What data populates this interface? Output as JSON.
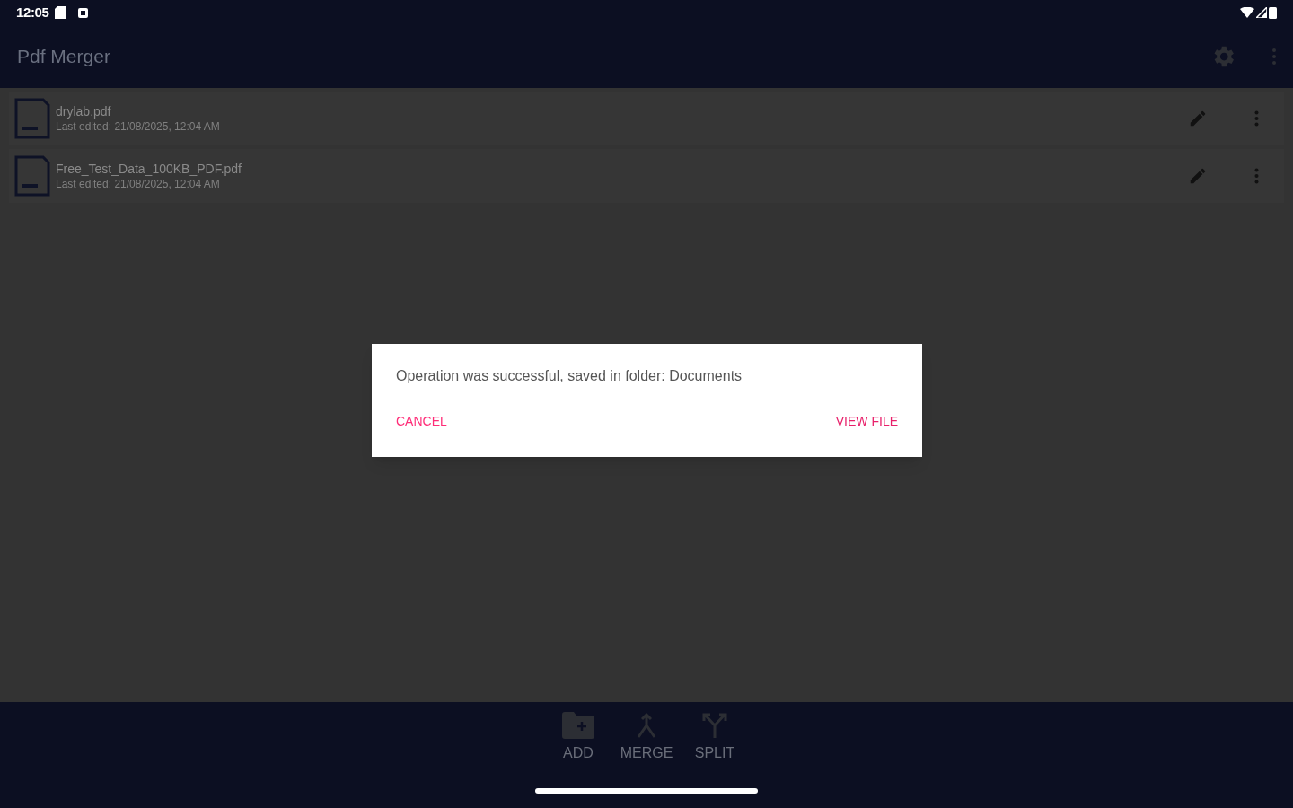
{
  "status_bar": {
    "time": "12:05"
  },
  "app_bar": {
    "title": "Pdf Merger"
  },
  "files": [
    {
      "name": "drylab.pdf",
      "subtitle": "Last edited: 21/08/2025, 12:04 AM"
    },
    {
      "name": "Free_Test_Data_100KB_PDF.pdf",
      "subtitle": "Last edited: 21/08/2025, 12:04 AM"
    }
  ],
  "dialog": {
    "message": "Operation was successful, saved in folder: Documents",
    "buttons": [
      {
        "label": "CANCEL",
        "kind": "cancel"
      },
      {
        "label": "VIEW FILE",
        "kind": "confirm"
      }
    ]
  },
  "bottom_nav": [
    {
      "label": "ADD",
      "kind": "add"
    },
    {
      "label": "MERGE",
      "kind": "merge"
    },
    {
      "label": "SPLIT",
      "kind": "split"
    }
  ]
}
